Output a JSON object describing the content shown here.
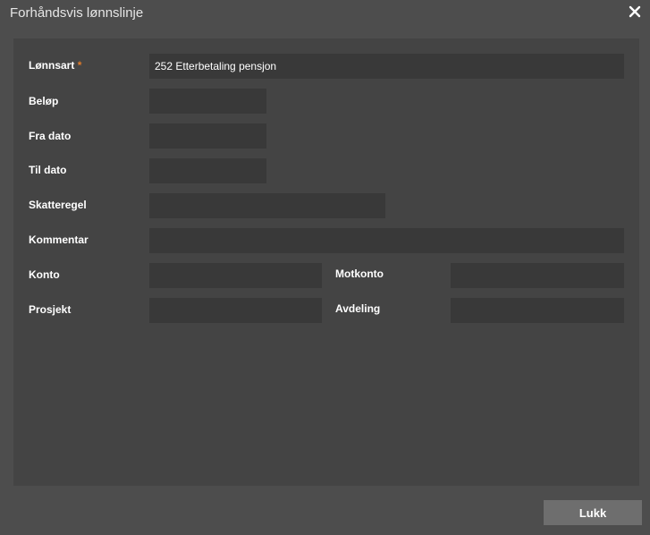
{
  "dialog": {
    "title": "Forhåndsvis lønnslinje",
    "close_icon": "close-icon"
  },
  "form": {
    "lonnsart": {
      "label": "Lønnsart",
      "required_mark": "*",
      "value": "252 Etterbetaling pensjon"
    },
    "belop": {
      "label": "Beløp",
      "value": ""
    },
    "fra_dato": {
      "label": "Fra dato",
      "value": ""
    },
    "til_dato": {
      "label": "Til dato",
      "value": ""
    },
    "skatteregel": {
      "label": "Skatteregel",
      "value": ""
    },
    "kommentar": {
      "label": "Kommentar",
      "value": ""
    },
    "konto": {
      "label": "Konto",
      "value": ""
    },
    "motkonto": {
      "label": "Motkonto",
      "value": ""
    },
    "prosjekt": {
      "label": "Prosjekt",
      "value": ""
    },
    "avdeling": {
      "label": "Avdeling",
      "value": ""
    }
  },
  "footer": {
    "close_label": "Lukk"
  },
  "colors": {
    "background": "#4d4d4d",
    "panel": "#444444",
    "field": "#393939",
    "button": "#6e6e6e",
    "required": "#e07b2a"
  }
}
